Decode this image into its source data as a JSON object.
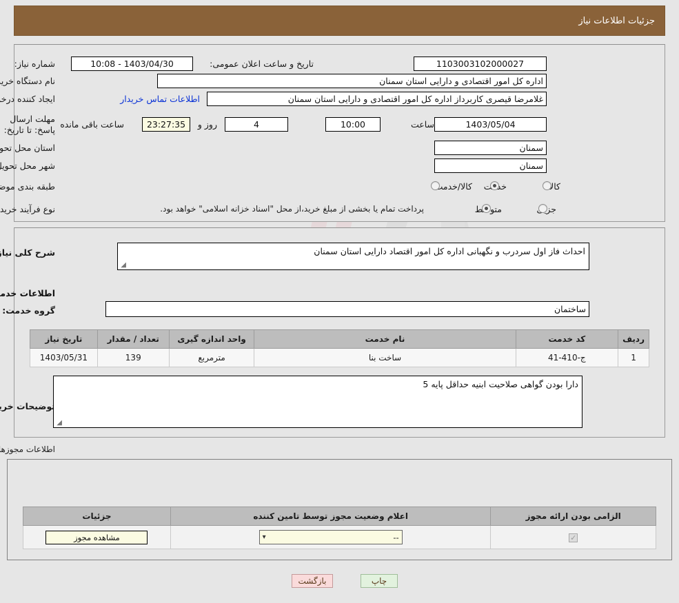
{
  "header": {
    "title": "جزئیات اطلاعات نیاز"
  },
  "summary": {
    "need_number_label": "شماره نیاز:",
    "need_number_value": "1103003102000027",
    "public_announce_label": "تاریخ و ساعت اعلان عمومی:",
    "public_announce_value": "1403/04/30 - 10:08",
    "buyer_org_label": "نام دستگاه خریدار:",
    "buyer_org_value": "اداره کل امور اقتصادی و دارایی استان سمنان",
    "creator_label": "ایجاد کننده درخواست:",
    "creator_value": "غلامرضا قیصری کاربرداز اداره کل امور اقتصادی و دارایی استان سمنان",
    "buyer_contact_link": "اطلاعات تماس خریدار",
    "deadline_label": "مهلت ارسال پاسخ: تا تاریخ:",
    "deadline_date": "1403/05/04",
    "hour_label": "ساعت",
    "deadline_time": "10:00",
    "days_value": "4",
    "days_and_label": "روز و",
    "countdown_value": "23:27:35",
    "remaining_label": "ساعت باقی مانده",
    "province_label": "استان محل تحویل:",
    "province_value": "سمنان",
    "city_label": "شهر محل تحویل:",
    "city_value": "سمنان",
    "category_label": "طبقه بندی موضوعی:",
    "category_options": [
      {
        "label": "کالا",
        "selected": false
      },
      {
        "label": "خدمت",
        "selected": true
      },
      {
        "label": "کالا/خدمت",
        "selected": false
      }
    ],
    "process_label": "نوع فرآیند خرید :",
    "process_options": [
      {
        "label": "جزیی",
        "selected": false
      },
      {
        "label": "متوسط",
        "selected": true
      }
    ],
    "payment_note": "پرداخت تمام یا بخشی از مبلغ خرید،از محل \"اسناد خزانه اسلامی\" خواهد بود."
  },
  "need": {
    "general_desc_label": "شرح کلی نیاز:",
    "general_desc_value": "احداث فاز اول سردرب و نگهبانی اداره کل امور اقتصاد دارایی استان سمنان",
    "services_section_title": "اطلاعات خدمات مورد نیاز",
    "service_group_label": "گروه خدمت:",
    "service_group_value": "ساختمان",
    "table": {
      "headers": [
        "ردیف",
        "کد خدمت",
        "نام خدمت",
        "واحد اندازه گیری",
        "تعداد / مقدار",
        "تاریخ نیاز"
      ],
      "rows": [
        {
          "row": "1",
          "code": "ج-410-41",
          "name": "ساخت بنا",
          "unit": "مترمربع",
          "quantity": "139",
          "date": "1403/05/31"
        }
      ]
    },
    "buyer_notes_label": "توضیحات خریدار:",
    "buyer_notes_value": "دارا بودن گواهی صلاحیت ابنیه حداقل پایه 5"
  },
  "permits": {
    "section_note": "اطلاعات مجوزهای ارائه خدمت / کالا",
    "headers": [
      "الزامی بودن ارائه مجوز",
      "اعلام وضعیت مجوز توسط تامین کننده",
      "جزئیات"
    ],
    "rows": [
      {
        "required_checked": true,
        "status_value": "--",
        "details_button": "مشاهده مجوز"
      }
    ]
  },
  "footer": {
    "back_button": "بازگشت",
    "print_button": "چاپ"
  },
  "watermark": {
    "text": "AriaTender.net"
  }
}
